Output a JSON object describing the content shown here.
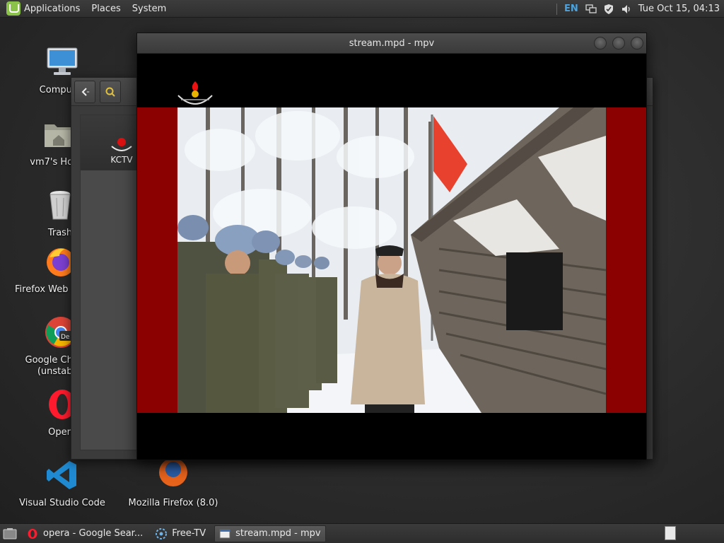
{
  "top_panel": {
    "menus": [
      "Applications",
      "Places",
      "System"
    ],
    "tray": {
      "language": "EN",
      "clock": "Tue Oct 15, 04:13"
    }
  },
  "desktop_icons": [
    {
      "label": "Computer",
      "icon": "computer-icon"
    },
    {
      "label": "vm7's Home",
      "icon": "home-folder-icon"
    },
    {
      "label": "Trash",
      "icon": "trash-icon"
    },
    {
      "label": "Firefox Web Browser",
      "icon": "firefox-icon"
    },
    {
      "label": "Google Chrome (unstable)",
      "icon": "chrome-dev-icon"
    },
    {
      "label": "Opera",
      "icon": "opera-icon"
    },
    {
      "label": "Visual Studio Code",
      "icon": "vscode-icon"
    },
    {
      "label": "Mozilla Firefox (8.0)",
      "icon": "firefox-old-icon"
    }
  ],
  "file_manager": {
    "sidebar_item_label": "KCTV"
  },
  "mpv": {
    "title": "stream.mpd - mpv"
  },
  "taskbar": {
    "items": [
      {
        "label": "opera - Google Sear...",
        "icon": "opera-icon"
      },
      {
        "label": "Free-TV",
        "icon": "free-tv-icon"
      },
      {
        "label": "stream.mpd - mpv",
        "icon": "mpv-icon"
      }
    ]
  },
  "colors": {
    "video_side_bar": "#8b0000",
    "flag": "#e8412e",
    "tray_lang": "#4aa3df",
    "mint_green": "#8bc34a"
  }
}
